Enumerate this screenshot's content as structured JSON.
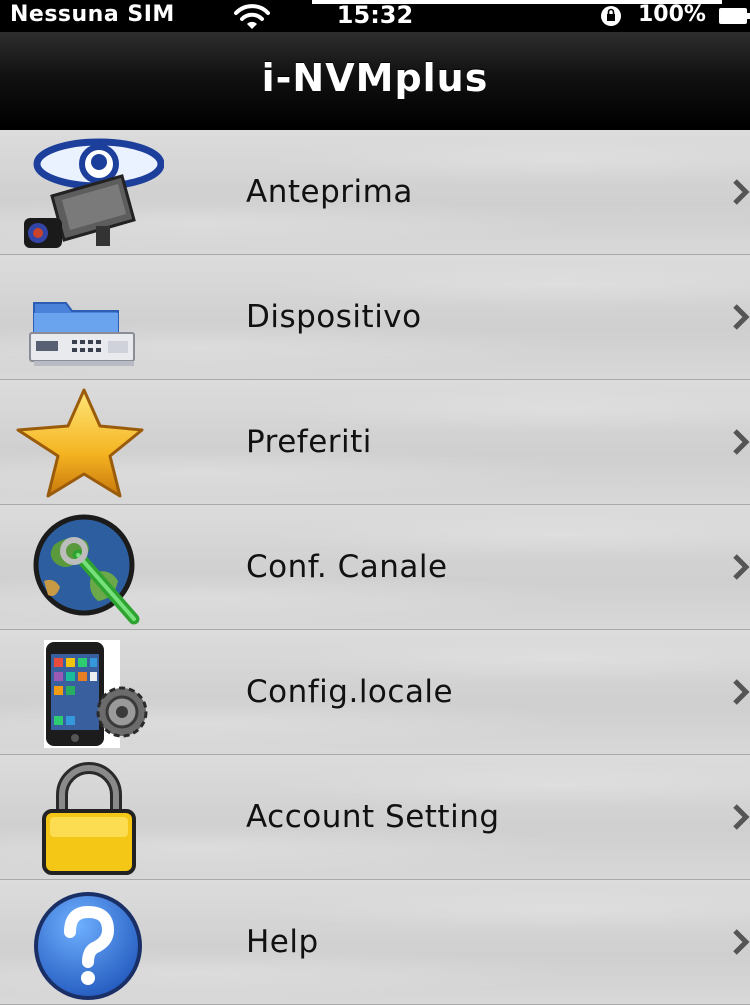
{
  "status_bar": {
    "carrier": "Nessuna SIM",
    "time": "15:32",
    "battery": "100%"
  },
  "nav": {
    "title": "i-NVMplus"
  },
  "menu": {
    "items": [
      {
        "label": "Anteprima",
        "icon": "surveillance-camera-eye-icon"
      },
      {
        "label": "Dispositivo",
        "icon": "dvr-device-folder-icon"
      },
      {
        "label": "Preferiti",
        "icon": "star-icon"
      },
      {
        "label": "Conf. Canale",
        "icon": "globe-wrench-icon"
      },
      {
        "label": "Config.locale",
        "icon": "phone-gear-icon"
      },
      {
        "label": "Account Setting",
        "icon": "padlock-icon"
      },
      {
        "label": "Help",
        "icon": "help-question-icon"
      }
    ]
  },
  "colors": {
    "nav_bg": "#000000",
    "row_bg": "#d3d3d3",
    "text": "#111111"
  }
}
